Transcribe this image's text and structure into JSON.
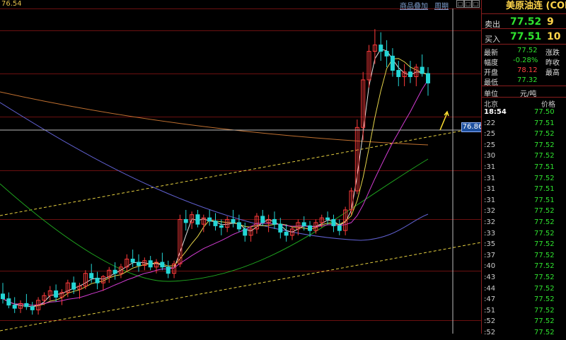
{
  "topbar": {
    "last_price": "76.54",
    "overlay_menu": "商品叠加",
    "period_menu": "周期",
    "window_buttons": [
      "□",
      "□",
      "□"
    ]
  },
  "crosshair_label": "76.86",
  "panel": {
    "title": "美原油连 (CONC",
    "sell_label": "卖出",
    "sell_price": "77.52",
    "sell_vol": "9",
    "buy_label": "买入",
    "buy_price": "77.51",
    "buy_vol": "10",
    "stats": [
      {
        "label": "最新",
        "value": "77.52",
        "label2": "涨跌",
        "color": "#2fe22f"
      },
      {
        "label": "幅度",
        "value": "-0.28%",
        "label2": "昨收",
        "color": "#2fe22f"
      },
      {
        "label": "开盘",
        "value": "78.12",
        "label2": "最高",
        "color": "#ff4040"
      },
      {
        "label": "最低",
        "value": "77.32",
        "label2": "",
        "color": "#2fe22f"
      }
    ],
    "unit_label": "单位",
    "unit_value": "元/吨",
    "col_location": "北京",
    "col_price": "价格",
    "ticks": [
      {
        "time": "18:54",
        "price": "77.50"
      },
      {
        "time": ":22",
        "price": "77.51"
      },
      {
        "time": ":25",
        "price": "77.52"
      },
      {
        "time": ":25",
        "price": "77.52"
      },
      {
        "time": ":30",
        "price": "77.52"
      },
      {
        "time": ":31",
        "price": "77.51"
      },
      {
        "time": ":31",
        "price": "77.52"
      },
      {
        "time": ":31",
        "price": "77.51"
      },
      {
        "time": ":31",
        "price": "77.51"
      },
      {
        "time": ":32",
        "price": "77.52"
      },
      {
        "time": ":32",
        "price": "77.52"
      },
      {
        "time": ":33",
        "price": "77.52"
      },
      {
        "time": ":35",
        "price": "77.52"
      },
      {
        "time": ":37",
        "price": "77.52"
      },
      {
        "time": ":40",
        "price": "77.52"
      },
      {
        "time": ":43",
        "price": "77.52"
      },
      {
        "time": ":44",
        "price": "77.52"
      },
      {
        "time": ":47",
        "price": "77.52"
      },
      {
        "time": ":51",
        "price": "77.52"
      },
      {
        "time": ":52",
        "price": "77.52"
      },
      {
        "time": ":52",
        "price": "77.52"
      }
    ]
  },
  "colors": {
    "up": "#ff3b3b",
    "down": "#24d6d6",
    "grid": "#6b1010",
    "ma_white": "#e0e0e0",
    "ma_yellow": "#e7d54a",
    "ma_magenta": "#d23cd2",
    "ma_green": "#1fa51f",
    "ma_blue": "#6060d0",
    "ma_orange": "#c07030"
  },
  "chart_data": {
    "type": "candlestick",
    "candles": [
      [
        76.05,
        76.12,
        75.99,
        76.02
      ],
      [
        76.02,
        76.06,
        75.96,
        75.98
      ],
      [
        75.98,
        76.03,
        75.93,
        75.96
      ],
      [
        75.96,
        76.01,
        75.93,
        75.99
      ],
      [
        75.99,
        76.05,
        75.95,
        75.97
      ],
      [
        75.97,
        76.0,
        75.92,
        75.95
      ],
      [
        75.95,
        76.03,
        75.92,
        76.01
      ],
      [
        76.01,
        76.06,
        75.98,
        76.04
      ],
      [
        76.04,
        76.1,
        76.01,
        76.07
      ],
      [
        76.07,
        76.11,
        76.0,
        76.03
      ],
      [
        76.03,
        76.08,
        75.98,
        76.06
      ],
      [
        76.06,
        76.14,
        76.03,
        76.12
      ],
      [
        76.12,
        76.16,
        76.05,
        76.08
      ],
      [
        76.08,
        76.12,
        76.02,
        76.1
      ],
      [
        76.1,
        76.2,
        76.08,
        76.18
      ],
      [
        76.18,
        76.24,
        76.12,
        76.15
      ],
      [
        76.15,
        76.19,
        76.08,
        76.12
      ],
      [
        76.12,
        76.17,
        76.07,
        76.16
      ],
      [
        76.16,
        76.22,
        76.12,
        76.2
      ],
      [
        76.2,
        76.25,
        76.14,
        76.18
      ],
      [
        76.18,
        76.24,
        76.15,
        76.22
      ],
      [
        76.22,
        76.3,
        76.19,
        76.27
      ],
      [
        76.27,
        76.33,
        76.22,
        76.25
      ],
      [
        76.25,
        76.3,
        76.19,
        76.23
      ],
      [
        76.23,
        76.28,
        76.2,
        76.26
      ],
      [
        76.26,
        76.29,
        76.2,
        76.22
      ],
      [
        76.22,
        76.27,
        76.18,
        76.25
      ],
      [
        76.25,
        76.31,
        76.2,
        76.22
      ],
      [
        76.22,
        76.26,
        76.15,
        76.18
      ],
      [
        76.18,
        76.26,
        76.15,
        76.24
      ],
      [
        76.24,
        76.55,
        76.22,
        76.52
      ],
      [
        76.52,
        76.58,
        76.45,
        76.5
      ],
      [
        76.5,
        76.57,
        76.46,
        76.55
      ],
      [
        76.55,
        76.58,
        76.47,
        76.49
      ],
      [
        76.49,
        76.55,
        76.44,
        76.53
      ],
      [
        76.53,
        76.58,
        76.48,
        76.51
      ],
      [
        76.51,
        76.56,
        76.45,
        76.48
      ],
      [
        76.48,
        76.52,
        76.42,
        76.47
      ],
      [
        76.47,
        76.54,
        76.44,
        76.52
      ],
      [
        76.52,
        76.58,
        76.47,
        76.5
      ],
      [
        76.5,
        76.55,
        76.44,
        76.46
      ],
      [
        76.46,
        76.5,
        76.38,
        76.42
      ],
      [
        76.42,
        76.48,
        76.38,
        76.46
      ],
      [
        76.46,
        76.56,
        76.43,
        76.54
      ],
      [
        76.54,
        76.58,
        76.48,
        76.5
      ],
      [
        76.5,
        76.55,
        76.44,
        76.52
      ],
      [
        76.52,
        76.57,
        76.46,
        76.49
      ],
      [
        76.49,
        76.53,
        76.4,
        76.44
      ],
      [
        76.44,
        76.49,
        76.38,
        76.42
      ],
      [
        76.42,
        76.48,
        76.39,
        76.46
      ],
      [
        76.46,
        76.52,
        76.42,
        76.5
      ],
      [
        76.5,
        76.54,
        76.45,
        76.48
      ],
      [
        76.48,
        76.51,
        76.41,
        76.45
      ],
      [
        76.45,
        76.52,
        76.43,
        76.5
      ],
      [
        76.5,
        76.55,
        76.47,
        76.53
      ],
      [
        76.53,
        76.57,
        76.49,
        76.52
      ],
      [
        76.52,
        76.55,
        76.44,
        76.48
      ],
      [
        76.48,
        76.52,
        76.42,
        76.45
      ],
      [
        76.45,
        76.6,
        76.42,
        76.58
      ],
      [
        76.58,
        76.72,
        76.55,
        76.7
      ],
      [
        76.7,
        77.15,
        76.68,
        77.1
      ],
      [
        77.1,
        77.45,
        77.02,
        77.4
      ],
      [
        77.4,
        77.62,
        77.35,
        77.58
      ],
      [
        77.58,
        77.72,
        77.5,
        77.62
      ],
      [
        77.62,
        77.7,
        77.52,
        77.58
      ],
      [
        77.58,
        77.65,
        77.48,
        77.55
      ],
      [
        77.55,
        77.6,
        77.42,
        77.46
      ],
      [
        77.46,
        77.52,
        77.36,
        77.42
      ],
      [
        77.42,
        77.5,
        77.36,
        77.45
      ],
      [
        77.45,
        77.52,
        77.38,
        77.42
      ],
      [
        77.42,
        77.5,
        77.36,
        77.48
      ],
      [
        77.48,
        77.56,
        77.42,
        77.44
      ],
      [
        77.44,
        77.48,
        77.3,
        77.38
      ]
    ],
    "ylim": [
      75.8,
      77.85
    ]
  }
}
